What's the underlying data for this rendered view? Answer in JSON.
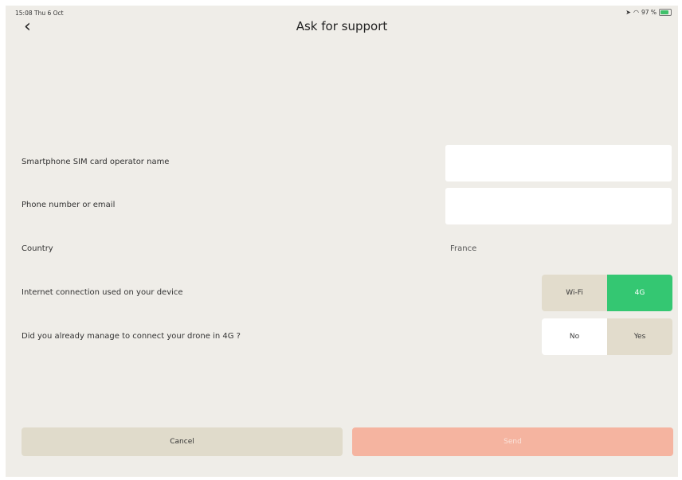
{
  "status_bar": {
    "time": "15:08  Thu 6 Oct",
    "battery": "97 %"
  },
  "header": {
    "back_icon": "chevron-left-icon",
    "title": "Ask for support"
  },
  "form": {
    "sim_operator": {
      "label": "Smartphone SIM card operator name",
      "value": ""
    },
    "contact": {
      "label": "Phone number or email",
      "value": ""
    },
    "country": {
      "label": "Country",
      "value": "France"
    },
    "connection": {
      "label": "Internet connection used on your device",
      "options": [
        "Wi-Fi",
        "4G"
      ],
      "selected": "4G"
    },
    "drone_4g": {
      "label": "Did you already manage to connect your drone in 4G ?",
      "options": [
        "No",
        "Yes"
      ],
      "selected": "No"
    }
  },
  "actions": {
    "cancel_label": "Cancel",
    "send_label": "Send"
  },
  "colors": {
    "background": "#efede8",
    "segment_idle": "#e2dccc",
    "selected_green": "#34c772",
    "send_disabled": "#f5b4a0",
    "cancel_bg": "#e0dbcb"
  }
}
